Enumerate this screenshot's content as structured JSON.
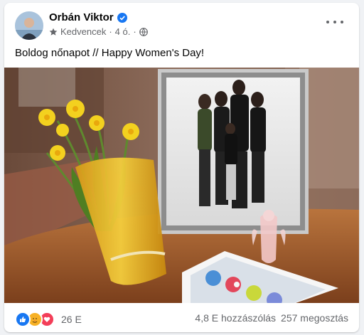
{
  "post": {
    "author": "Orbán Viktor",
    "audience": "Kedvencek",
    "time": "4 ó.",
    "text": "Boldog nőnapot // Happy Women's Day!",
    "reaction_count": "26 E",
    "comments": "4,8 E hozzászólás",
    "shares": "257 megosztás"
  },
  "icons": {
    "verified": "verified-badge-icon",
    "favorites": "star-icon",
    "privacy": "globe-icon",
    "reactions": [
      "like-icon",
      "care-icon",
      "love-icon"
    ]
  },
  "colors": {
    "accent": "#1877f2",
    "love": "#f33e58",
    "care": "#f7b125"
  }
}
